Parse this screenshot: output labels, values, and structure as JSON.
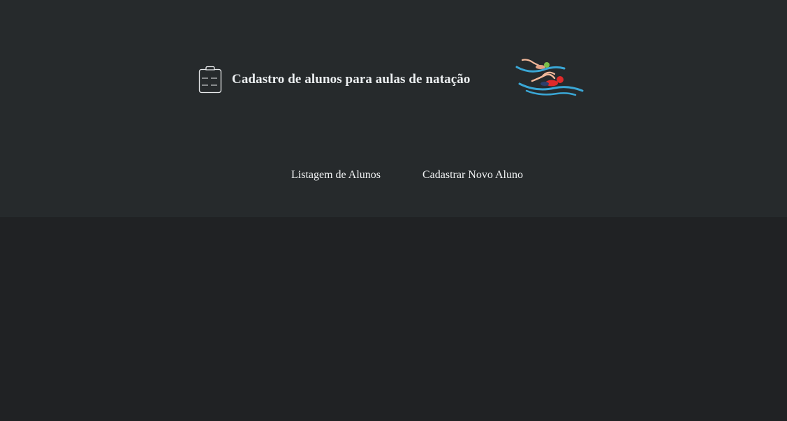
{
  "header": {
    "title": "Cadastro de alunos para aulas de natação",
    "icons": {
      "clipboard": "clipboard-icon",
      "swimmers": "swimmers-illustration"
    }
  },
  "nav": {
    "items": [
      {
        "label": "Listagem de Alunos"
      },
      {
        "label": "Cadastrar Novo Aluno"
      }
    ]
  },
  "colors": {
    "header_bg": "#262a2c",
    "page_bg": "#202224",
    "text": "#eceff1",
    "water": "#3aa7d6",
    "cap_red": "#e02a2a",
    "cap_green": "#7cc04b"
  }
}
